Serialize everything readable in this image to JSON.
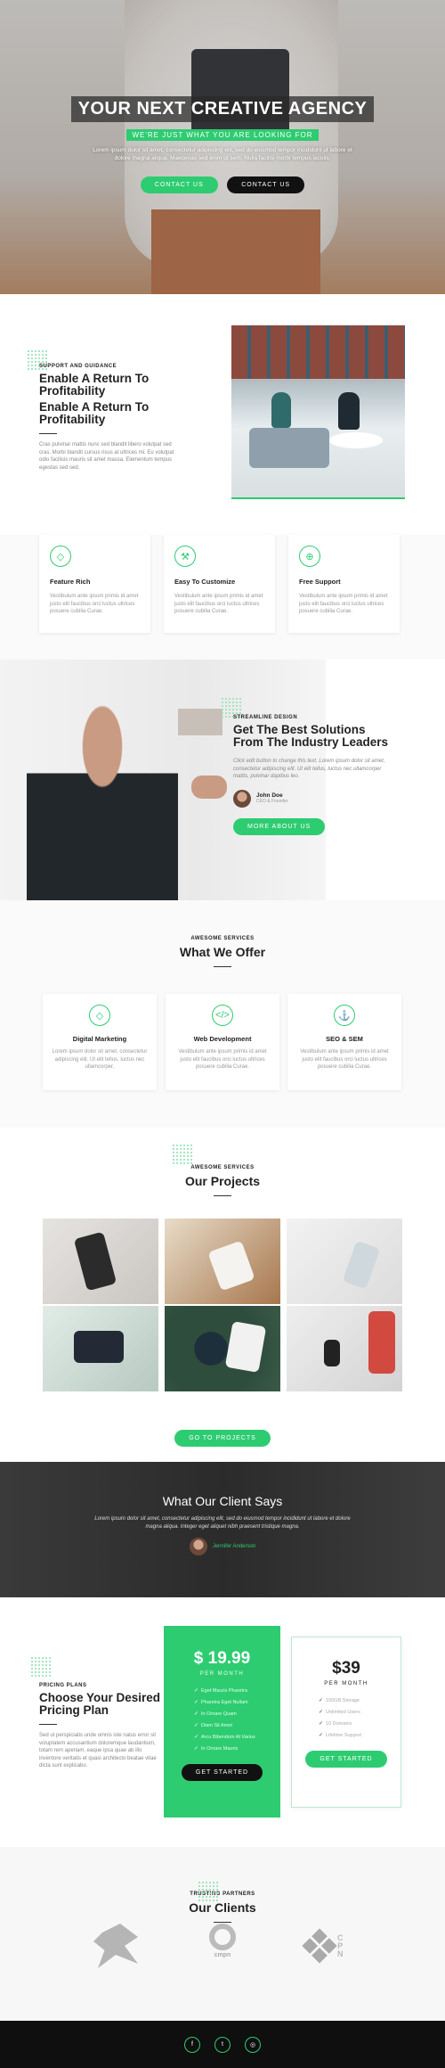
{
  "hero": {
    "title": "YOUR NEXT CREATIVE AGENCY",
    "subtitle": "WE'RE JUST WHAT YOU ARE LOOKING FOR",
    "description": "Lorem ipsum dolor sit amet, consectetur adipiscing elit, sed do eiusmod tempor incididunt ut labore et dolore magna aliqua. Maecenas sed enim ut sem. Nulla facilisi morbi tempus iaculis.",
    "contact_us_green": "CONTACT US",
    "contact_us_dark": "CONTACT US"
  },
  "about": {
    "kicker": "SUPPORT AND GUIDANCE",
    "title_line1": "Enable A Return To Profitability",
    "title_line2": "Enable A Return To Profitability",
    "body": "Cras pulvinar mattis nunc sed blandit libero volutpat sed cras. Morbi blandit cursus risus at ultrices mi. Eu volutpat odio facilisis mauris sit amet massa. Elementum tempus egestas sed sed."
  },
  "features": [
    {
      "title": "Feature Rich",
      "body": "Vestibulum ante ipsum primis id amet justo elit faucibus orci luctus ultrices posuere cubilia Curae."
    },
    {
      "title": "Easy To Customize",
      "body": "Vestibulum ante ipsum primis id amet justo elit faucibus orci luctus ultrices posuere cubilia Curae."
    },
    {
      "title": "Free Support",
      "body": "Vestibulum ante ipsum primis id amet justo elit faucibus orci luctus ultrices posuere cubilia Curae."
    }
  ],
  "streamline": {
    "kicker": "STREAMLINE DESIGN",
    "title": "Get The Best Solutions From The Industry Leaders",
    "body": "Click edit button to change this text. Lorem ipsum dolor sit amet, consectetur adipiscing elit. Ut elit tellus, luctus nec ullamcorper mattis, pulvinar dapibus leo.",
    "author_name": "John Doe",
    "author_role": "CEO & Founder",
    "button": "MORE ABOUT US"
  },
  "services": {
    "kicker": "AWESOME SERVICES",
    "title": "What We Offer",
    "items": [
      {
        "title": "Digital Marketing",
        "body": "Lorem ipsum dolor sit amet, consectetur adipiscing elit. Ut elit tellus, luctus nec ullamcorper."
      },
      {
        "title": "Web Development",
        "body": "Vestibulum ante ipsum primis id amet justo elit faucibus orci luctus ultrices posuere cubilia Curae."
      },
      {
        "title": "SEO & SEM",
        "body": "Vestibulum ante ipsum primis id amet justo elit faucibus orci luctus ultrices posuere cubilia Curae."
      }
    ]
  },
  "projects": {
    "kicker": "AWESOME SERVICES",
    "title": "Our Projects",
    "button": "GO TO PROJECTS"
  },
  "testimonial": {
    "title": "What Our Client Says",
    "quote": "Lorem ipsum dolor sit amet, consectetur adipiscing elit, sed do eiusmod tempor incididunt ut labore et dolore magna aliqua. Integer eget aliquet nibh praesent tristique magna.",
    "name": "Jennifer Anderson"
  },
  "pricing": {
    "kicker": "PRICING PLANS",
    "title": "Choose Your Desired Pricing Plan",
    "body": "Sed ut perspiciatis unde omnis iste natus error sit voluptatem accusantium doloremque laudantium, totam rem aperiam, eaque ipsa quae ab illo inventore veritatis et quasi architecto beatae vitae dicta sunt explicabo.",
    "plan1": {
      "price": "$ 19.99",
      "period": "PER MONTH",
      "features": [
        "Eget Mauris Pharetra",
        "Pharetra Eget Nullam",
        "In Ornare Quam",
        "Diam Sit Amet",
        "Arcu Bibendum At Varius",
        "In Ornare Mauris"
      ],
      "button": "GET STARTED"
    },
    "plan2": {
      "price": "$39",
      "period": "PER MONTH",
      "features": [
        "100GB Storage",
        "Unlimited Users",
        "10 Domains",
        "Lifetime Support"
      ],
      "button": "GET STARTED"
    }
  },
  "clients": {
    "kicker": "TRUSTING PARTNERS",
    "title": "Our Clients",
    "logo2_text": "cmpn",
    "logo3_text": "C\nP\nN"
  },
  "footer": {
    "icons": [
      "f",
      "t",
      "◎"
    ]
  }
}
